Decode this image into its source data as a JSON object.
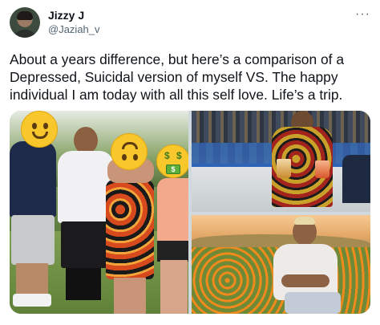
{
  "author": {
    "name": "Jizzy J",
    "handle": "@Jaziah_v",
    "avatar_icon": "profile-avatar"
  },
  "menu": {
    "icon": "more-options-icon",
    "glyph": "···"
  },
  "tweet": {
    "text": "About a years difference, but here’s a comparison of a Depressed, Suicidal version of myself VS. The happy individual I am today with all this self love. Life’s a trip."
  },
  "media": {
    "photo_count": 3,
    "emoji": {
      "smile": "smiling-face-emoji",
      "upside_down": "upside-down-face-emoji",
      "money": "money-mouth-face-emoji"
    },
    "money_signs": {
      "left": "$",
      "right": "$",
      "bill": "$"
    }
  },
  "colors": {
    "text": "#0f1419",
    "secondary": "#536471",
    "emoji_yellow": "#f7c72b"
  }
}
